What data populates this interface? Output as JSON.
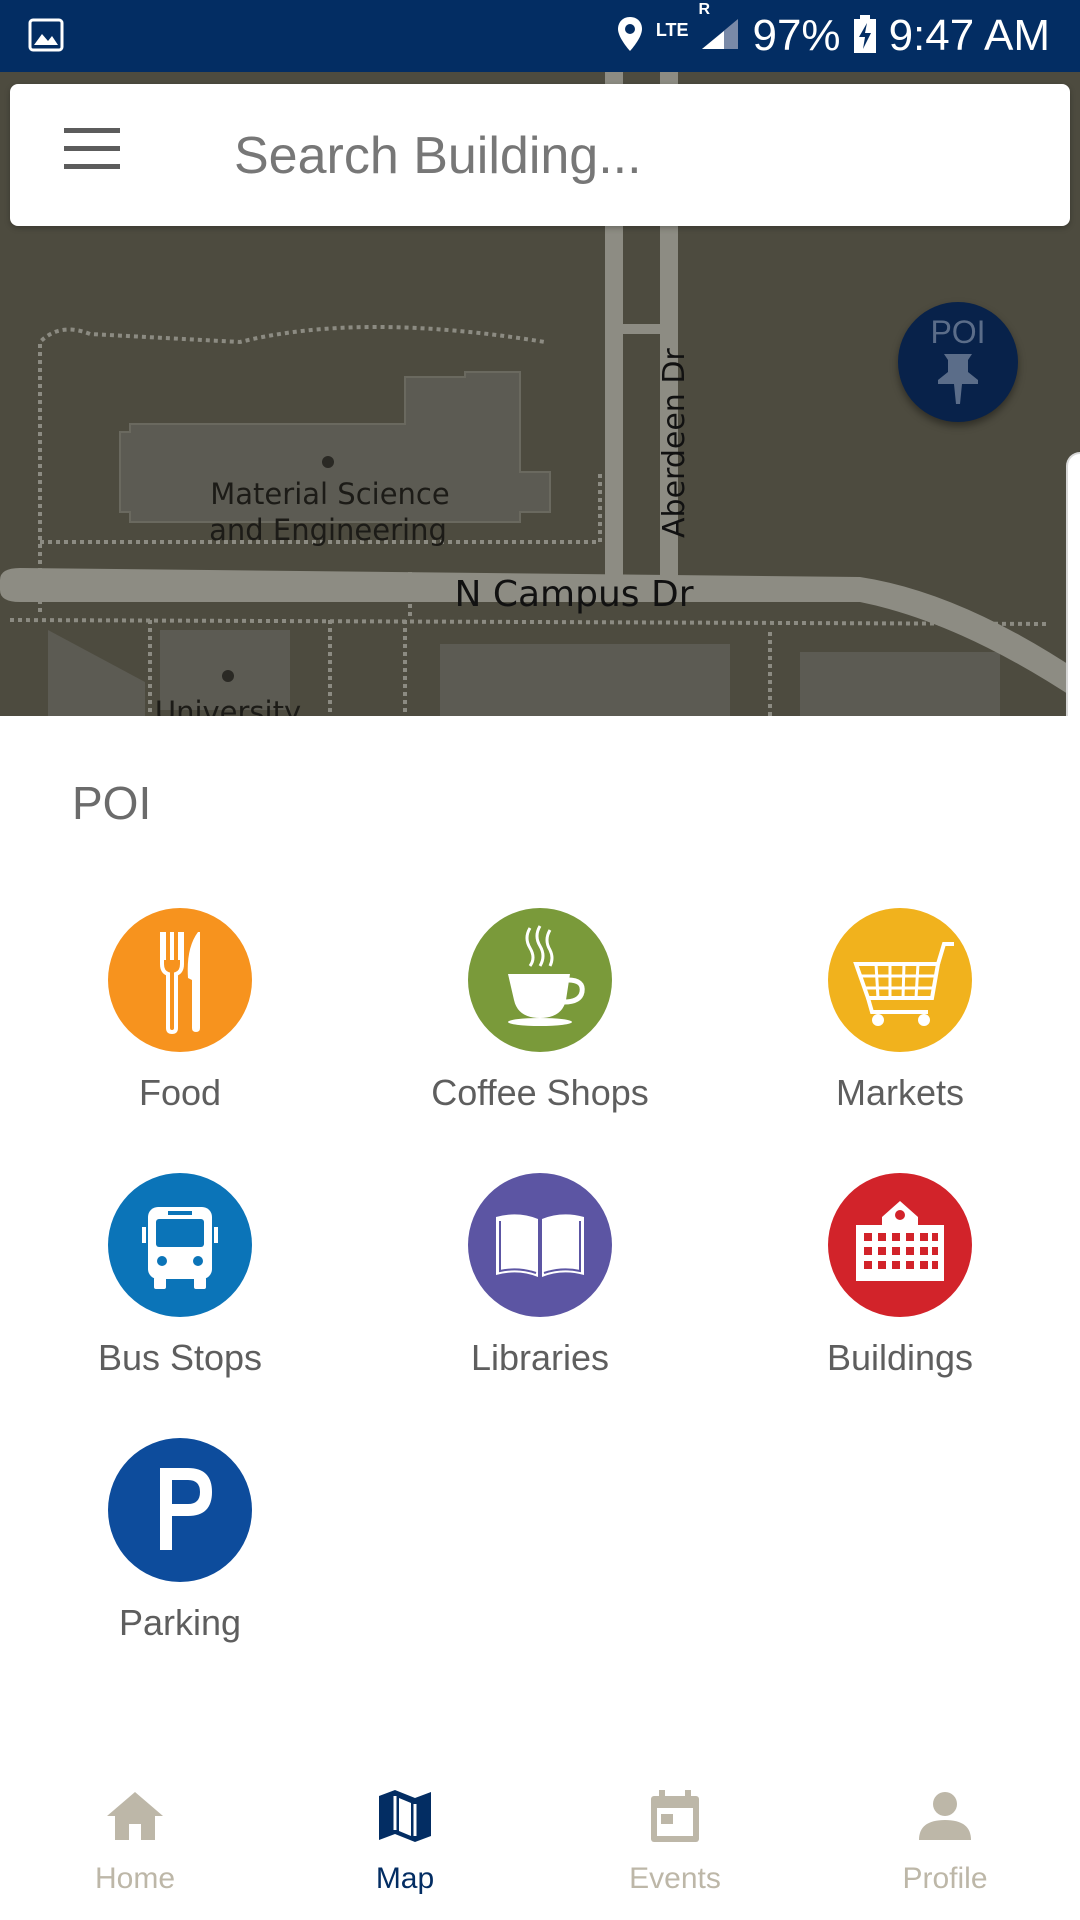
{
  "status_bar": {
    "battery": "97%",
    "time": "9:47 AM",
    "network": "LTE",
    "roaming": "R"
  },
  "search": {
    "placeholder": "Search Building..."
  },
  "map": {
    "labels": {
      "building_1_line1": "Material Science",
      "building_1_line2": "and Engineering",
      "street_1": "N Campus Dr",
      "street_2": "Aberdeen Dr",
      "building_2": "University"
    },
    "poi_button_label": "POI"
  },
  "panel": {
    "title": "POI",
    "items": [
      {
        "label": "Food",
        "icon": "fork-knife-icon",
        "color": "#f7931e"
      },
      {
        "label": "Coffee Shops",
        "icon": "coffee-cup-icon",
        "color": "#7a9a3a"
      },
      {
        "label": "Markets",
        "icon": "shopping-cart-icon",
        "color": "#f1b21d"
      },
      {
        "label": "Bus Stops",
        "icon": "bus-icon",
        "color": "#0b74b8"
      },
      {
        "label": "Libraries",
        "icon": "book-icon",
        "color": "#5c55a3"
      },
      {
        "label": "Buildings",
        "icon": "school-building-icon",
        "color": "#d2232a"
      },
      {
        "label": "Parking",
        "icon": "parking-icon",
        "color": "#0d4c9c"
      }
    ]
  },
  "bottom_nav": {
    "items": [
      {
        "label": "Home",
        "icon": "home-icon",
        "active": false
      },
      {
        "label": "Map",
        "icon": "map-icon",
        "active": true
      },
      {
        "label": "Events",
        "icon": "calendar-icon",
        "active": false
      },
      {
        "label": "Profile",
        "icon": "person-icon",
        "active": false
      }
    ]
  },
  "colors": {
    "status_bar": "#032d63",
    "active_nav": "#032d63",
    "inactive_nav": "#bdb7a8",
    "map_background": "#4b4a3e"
  }
}
